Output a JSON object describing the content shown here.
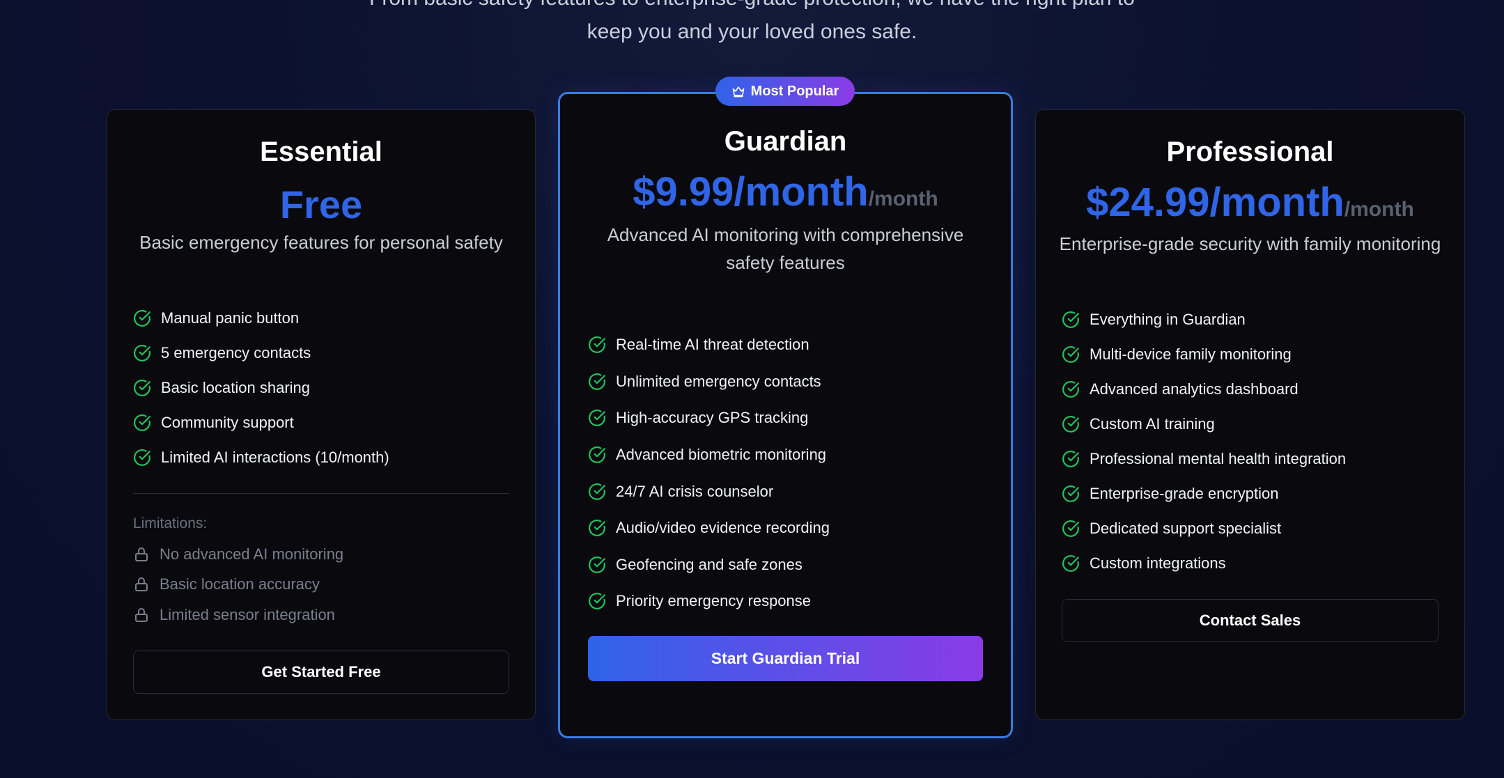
{
  "intro": {
    "line1": "From basic safety features to enterprise-grade protection, we have the right plan to",
    "line2": "keep you and your loved ones safe."
  },
  "badge": {
    "label": "Most Popular",
    "icon": "crown-icon"
  },
  "plans": {
    "essential": {
      "name": "Essential",
      "price": "Free",
      "description": "Basic emergency features for personal safety",
      "features": [
        "Manual panic button",
        "5 emergency contacts",
        "Basic location sharing",
        "Community support",
        "Limited AI interactions (10/month)"
      ],
      "limitations_title": "Limitations:",
      "limitations": [
        "No advanced AI monitoring",
        "Basic location accuracy",
        "Limited sensor integration"
      ],
      "button": "Get Started Free"
    },
    "guardian": {
      "name": "Guardian",
      "price": "$9.99/month",
      "period": "/month",
      "description_line1": "Advanced AI monitoring with comprehensive",
      "description_line2": "safety features",
      "features": [
        "Real-time AI threat detection",
        "Unlimited emergency contacts",
        "High-accuracy GPS tracking",
        "Advanced biometric monitoring",
        "24/7 AI crisis counselor",
        "Audio/video evidence recording",
        "Geofencing and safe zones",
        "Priority emergency response"
      ],
      "button": "Start Guardian Trial"
    },
    "professional": {
      "name": "Professional",
      "price": "$24.99/month",
      "period": "/month",
      "description": "Enterprise-grade security with family monitoring",
      "features": [
        "Everything in Guardian",
        "Multi-device family monitoring",
        "Advanced analytics dashboard",
        "Custom AI training",
        "Professional mental health integration",
        "Enterprise-grade encryption",
        "Dedicated support specialist",
        "Custom integrations"
      ],
      "button": "Contact Sales"
    }
  },
  "colors": {
    "accent": "#2f65e6",
    "check": "#22c55e",
    "gradient_start": "#2f63e8",
    "gradient_end": "#8a3be6"
  }
}
